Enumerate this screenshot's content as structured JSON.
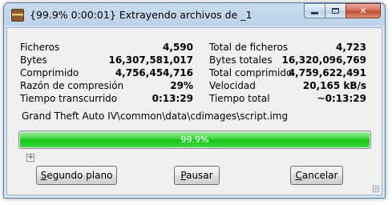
{
  "window": {
    "title": "{99.9% 0:00:01} Extrayendo archivos de _1",
    "close_symbol": "✕"
  },
  "stats_left": [
    {
      "label": "Ficheros",
      "value": "4,590"
    },
    {
      "label": "Bytes",
      "value": "16,307,581,017"
    },
    {
      "label": "Comprimido",
      "value": "4,756,454,716"
    },
    {
      "label": "Razón de compresión",
      "value": "29%"
    },
    {
      "label": "Tiempo transcurrido",
      "value": "0:13:29"
    }
  ],
  "stats_right": [
    {
      "label": "Total de ficheros",
      "value": "4,723"
    },
    {
      "label": "Bytes totales",
      "value": "16,320,096,769"
    },
    {
      "label": "Total comprimido",
      "value": "4,759,622,491"
    },
    {
      "label": "Velocidad",
      "value": "20,165 kB/s"
    },
    {
      "label": "Tiempo total",
      "value": "~0:13:29"
    }
  ],
  "current_file": "Grand Theft Auto IV\\common\\data\\cdimages\\script.img",
  "progress": {
    "text": "99.9%",
    "fraction": 0.999,
    "color": "#37d437"
  },
  "expand_symbol": "+",
  "buttons": {
    "background": {
      "pre": "",
      "accel": "S",
      "post": "egundo plano"
    },
    "pause": {
      "pre": "",
      "accel": "P",
      "post": "ausar"
    },
    "cancel": {
      "pre": "",
      "accel": "C",
      "post": "ancelar"
    }
  }
}
